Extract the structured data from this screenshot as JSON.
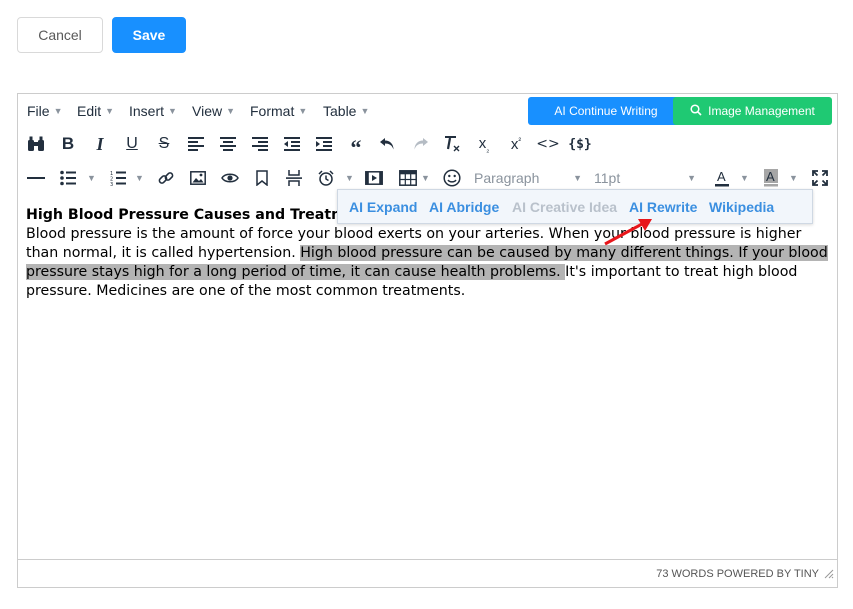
{
  "actions": {
    "cancel_label": "Cancel",
    "save_label": "Save"
  },
  "menubar": {
    "items": [
      "File",
      "Edit",
      "Insert",
      "View",
      "Format",
      "Table"
    ],
    "ai_continue_label": "AI Continue Writing",
    "image_management_label": "Image Management"
  },
  "toolbar": {
    "row1_icons": [
      "binoculars-icon",
      "bold-icon",
      "italic-icon",
      "underline-icon",
      "strikethrough-icon",
      "align-left-icon",
      "align-center-icon",
      "align-right-icon",
      "outdent-icon",
      "indent-icon",
      "blockquote-icon",
      "undo-icon",
      "redo-icon",
      "clear-formatting-icon",
      "subscript-icon",
      "superscript-icon",
      "code-icon",
      "template-icon"
    ],
    "row2_icons": [
      "horizontal-rule-icon",
      "bullet-list-icon",
      "numbered-list-icon",
      "link-icon",
      "image-icon",
      "preview-icon",
      "bookmark-icon",
      "page-break-icon",
      "alarm-icon",
      "media-icon",
      "table-icon",
      "emoticons-icon",
      "text-color-icon",
      "highlight-color-icon",
      "fullscreen-icon"
    ],
    "block_format": "Paragraph",
    "font_size": "11pt"
  },
  "content": {
    "heading": "High Blood Pressure Causes and Treatm",
    "para_start": "Blood pressure is the amount of force your blood exerts on your arteries. When your blood pressure is higher than normal, it is called hypertension. ",
    "para_selected": "High blood pressure can be caused by many different things. If your blood pressure stays high for a long period of time, it can cause health problems. ",
    "para_end": "It's important to treat high blood pressure. Medicines are one of the most common treatments."
  },
  "ai_popup": {
    "expand": "AI Expand",
    "abridge": "AI Abridge",
    "creative": "AI Creative Idea",
    "rewrite": "AI Rewrite",
    "wikipedia": "Wikipedia"
  },
  "status": {
    "text": "73 WORDS POWERED BY TINY"
  },
  "colors": {
    "primary": "#1890ff",
    "green": "#1fc973",
    "selection": "#b4b4b4",
    "arrow": "#e8161b"
  }
}
